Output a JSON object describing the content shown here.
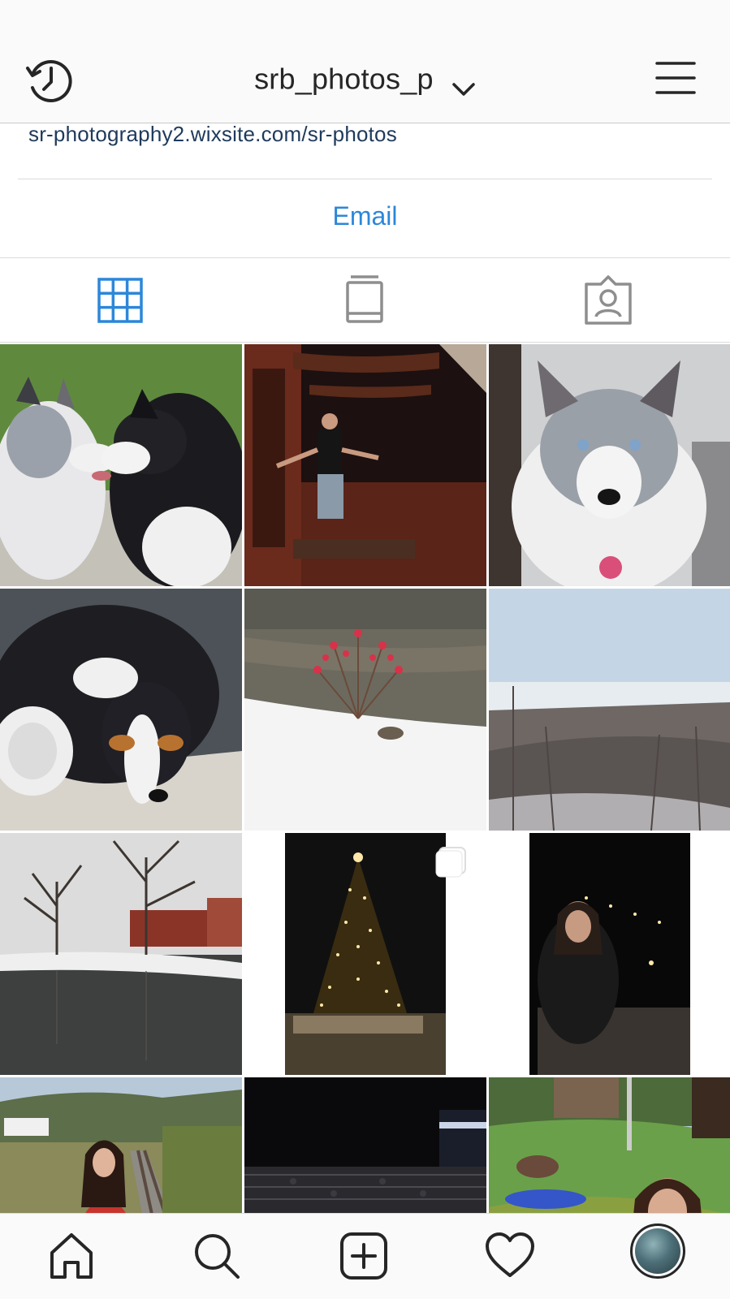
{
  "header": {
    "username": "srb_photos_p",
    "icons": {
      "left": "history-icon",
      "dropdown": "chevron-down-icon",
      "right": "menu-icon"
    }
  },
  "bio": {
    "website": "sr-photography2.wixsite.com/sr-photos"
  },
  "contact": {
    "email_label": "Email"
  },
  "tabs": [
    {
      "icon": "grid-icon",
      "active": true
    },
    {
      "icon": "feed-icon",
      "active": false
    },
    {
      "icon": "tagged-icon",
      "active": false
    }
  ],
  "grid": {
    "posts": [
      {
        "subject": "two-shelties-icon",
        "row": 1,
        "col": 1
      },
      {
        "subject": "jumping-man-icon",
        "row": 1,
        "col": 2
      },
      {
        "subject": "sheltie-portrait-icon",
        "row": 1,
        "col": 3
      },
      {
        "subject": "sheltie-closeup-icon",
        "row": 2,
        "col": 1
      },
      {
        "subject": "red-bush-snow-icon",
        "row": 2,
        "col": 2
      },
      {
        "subject": "winter-valley-icon",
        "row": 2,
        "col": 3
      },
      {
        "subject": "river-trees-icon",
        "row": 3,
        "col": 1
      },
      {
        "subject": "christmas-tree-icon",
        "row": 3,
        "col": 2,
        "multi": true
      },
      {
        "subject": "night-portrait-icon",
        "row": 3,
        "col": 3
      },
      {
        "subject": "railroad-portrait-icon",
        "row": 4,
        "col": 1
      },
      {
        "subject": "night-bleachers-icon",
        "row": 4,
        "col": 2
      },
      {
        "subject": "lawn-portrait-icon",
        "row": 4,
        "col": 3
      }
    ]
  },
  "bottom_nav": [
    {
      "icon": "home-icon"
    },
    {
      "icon": "search-icon"
    },
    {
      "icon": "add-post-icon"
    },
    {
      "icon": "heart-icon"
    },
    {
      "icon": "avatar"
    }
  ],
  "colors": {
    "accent": "#2c87d9",
    "link": "#1e3a5c",
    "text": "#262626",
    "inactive_icon": "#8e8e8e"
  }
}
